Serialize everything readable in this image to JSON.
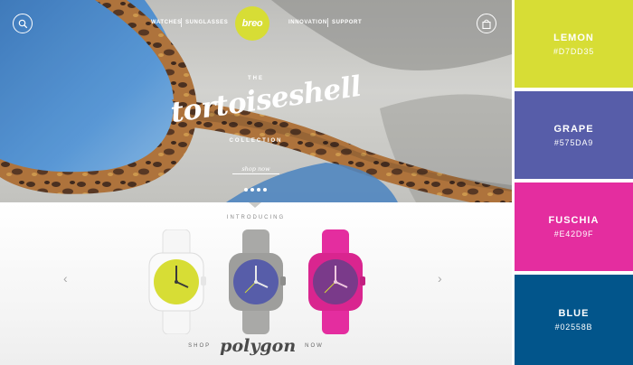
{
  "nav": {
    "links": [
      "WATCHES",
      "SUNGLASSES",
      "INNOVATION",
      "SUPPORT"
    ],
    "logo": "breo"
  },
  "hero": {
    "the": "THE",
    "title": "tortoiseshell",
    "subtitle": "COLLECTION",
    "cta": "shop now"
  },
  "product": {
    "introducing": "INTRODUCING",
    "shop": "SHOP",
    "brand": "polygon",
    "now": "NOW",
    "watches": [
      {
        "strap": "#f4f4f4",
        "dial": "#d7dd35"
      },
      {
        "strap": "#a8a8a6",
        "dial": "#575da9"
      },
      {
        "strap": "#e42d9f",
        "dial": "#7a3a8a"
      }
    ]
  },
  "swatches": [
    {
      "name": "LEMON",
      "hex": "#D7DD35",
      "color": "#d7dd35"
    },
    {
      "name": "GRAPE",
      "hex": "#575DA9",
      "color": "#575da9"
    },
    {
      "name": "FUSCHIA",
      "hex": "#E42D9F",
      "color": "#e42d9f"
    },
    {
      "name": "BLUE",
      "hex": "#02558B",
      "color": "#02558b"
    }
  ]
}
